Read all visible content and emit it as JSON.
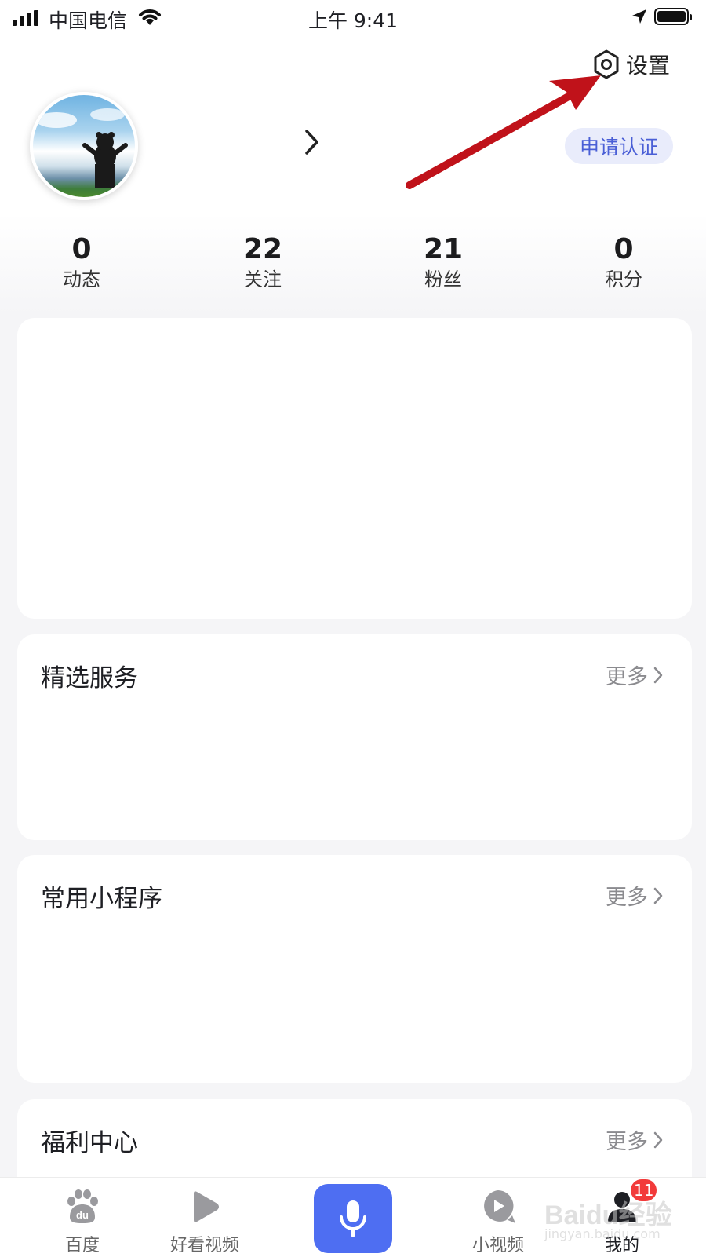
{
  "status_bar": {
    "carrier": "中国电信",
    "time": "上午 9:41"
  },
  "header": {
    "settings_label": "设置",
    "verify_label": "申请认证"
  },
  "stats": [
    {
      "value": "0",
      "label": "动态"
    },
    {
      "value": "22",
      "label": "关注"
    },
    {
      "value": "21",
      "label": "粉丝"
    },
    {
      "value": "0",
      "label": "积分"
    }
  ],
  "sections": [
    {
      "title": "精选服务",
      "more": "更多"
    },
    {
      "title": "常用小程序",
      "more": "更多"
    },
    {
      "title": "福利中心",
      "more": "更多"
    }
  ],
  "tabbar": {
    "items": [
      {
        "label": "百度",
        "icon": "baidu-paw-icon"
      },
      {
        "label": "好看视频",
        "icon": "play-icon"
      },
      {
        "label": "",
        "icon": "microphone-icon"
      },
      {
        "label": "小视频",
        "icon": "small-video-icon"
      },
      {
        "label": "我的",
        "icon": "user-icon"
      }
    ],
    "badge": "11"
  },
  "watermark": {
    "line1": "Baidu经验",
    "line2": "jingyan.baidu.com"
  },
  "colors": {
    "accent": "#4e6ef2",
    "verify_bg": "#e9ecfb",
    "verify_text": "#4a5fd6",
    "badge": "#f23a3a",
    "annotation_arrow": "#c0121a"
  }
}
